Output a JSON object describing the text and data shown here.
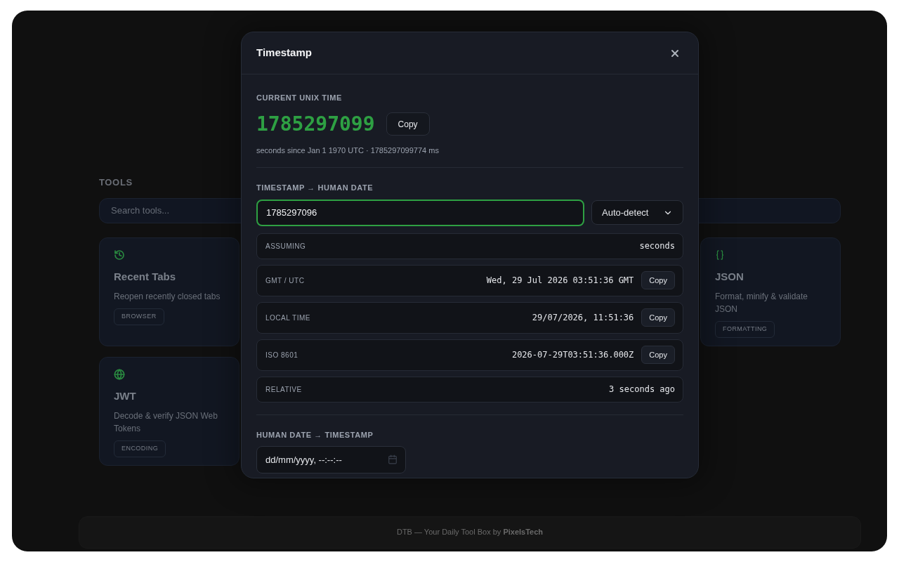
{
  "background": {
    "tools_heading": "TOOLS",
    "search": {
      "placeholder": "Search tools..."
    },
    "tool_cards": [
      {
        "title": "Recent Tabs",
        "description": "Reopen recently closed tabs",
        "tag": "BROWSER"
      },
      {
        "title": "JSON",
        "description": "Format, minify & validate JSON",
        "tag": "FORMATTING"
      },
      {
        "title": "JWT",
        "description": "Decode & verify JSON Web Tokens",
        "tag": "ENCODING"
      }
    ],
    "footer": "DTB — Your Daily Tool Box by **PixelsTech**"
  },
  "dialog": {
    "title": "Timestamp",
    "current": {
      "label": "CURRENT UNIX TIME",
      "value": "1785297099",
      "copy": "Copy",
      "note": "seconds since Jan 1 1970 UTC · 1785297099774 ms"
    },
    "converter": {
      "label": "TIMESTAMP → HUMAN DATE",
      "input": {
        "value": "1785297096",
        "focused": true
      },
      "unit_select": "Auto-detect",
      "results": [
        {
          "label": "ASSUMING",
          "value": "seconds"
        },
        {
          "label": "GMT / UTC",
          "value": "Wed, 29 Jul 2026 03:51:36 GMT",
          "copy": "Copy"
        },
        {
          "label": "LOCAL TIME",
          "value": "29/07/2026, 11:51:36",
          "copy": "Copy"
        },
        {
          "label": "ISO 8601",
          "value": "2026-07-29T03:51:36.000Z",
          "copy": "Copy"
        },
        {
          "label": "RELATIVE",
          "value": "3 seconds ago"
        }
      ]
    },
    "reverse": {
      "label": "HUMAN DATE → TIMESTAMP",
      "date_field": {
        "placeholder": "dd/mm/yyyy, --:--:--"
      }
    }
  }
}
